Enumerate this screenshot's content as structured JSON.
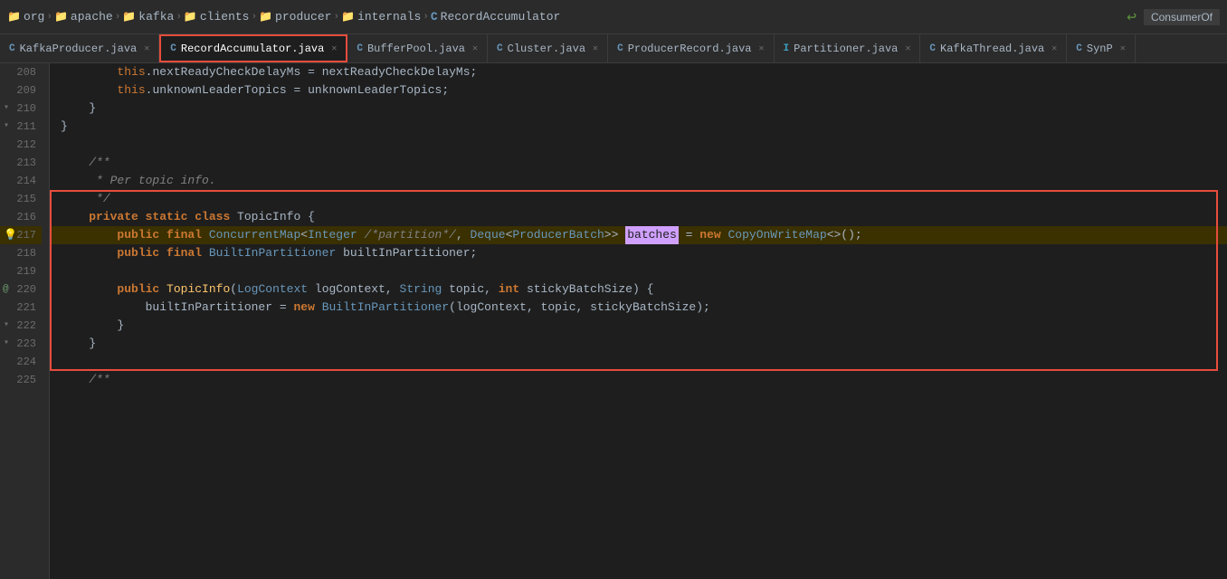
{
  "breadcrumb": {
    "items": [
      {
        "type": "folder",
        "label": "org"
      },
      {
        "type": "folder",
        "label": "apache"
      },
      {
        "type": "folder",
        "label": "kafka"
      },
      {
        "type": "folder",
        "label": "clients"
      },
      {
        "type": "folder",
        "label": "producer"
      },
      {
        "type": "folder",
        "label": "internals"
      },
      {
        "type": "class",
        "label": "RecordAccumulator"
      }
    ],
    "right_icon": "↩",
    "right_label": "ConsumerOf"
  },
  "tabs": [
    {
      "id": "kafka-producer",
      "label": "KafkaProducer.java",
      "icon": "C",
      "icon_type": "java",
      "active": false,
      "highlighted": false
    },
    {
      "id": "record-accumulator",
      "label": "RecordAccumulator.java",
      "icon": "C",
      "icon_type": "java",
      "active": true,
      "highlighted": true
    },
    {
      "id": "buffer-pool",
      "label": "BufferPool.java",
      "icon": "C",
      "icon_type": "java",
      "active": false,
      "highlighted": false
    },
    {
      "id": "cluster",
      "label": "Cluster.java",
      "icon": "C",
      "icon_type": "java",
      "active": false,
      "highlighted": false
    },
    {
      "id": "producer-record",
      "label": "ProducerRecord.java",
      "icon": "C",
      "icon_type": "java",
      "active": false,
      "highlighted": false
    },
    {
      "id": "partitioner",
      "label": "Partitioner.java",
      "icon": "I",
      "icon_type": "interface",
      "active": false,
      "highlighted": false
    },
    {
      "id": "kafka-thread",
      "label": "KafkaThread.java",
      "icon": "C",
      "icon_type": "java",
      "active": false,
      "highlighted": false
    },
    {
      "id": "synp",
      "label": "SynP",
      "icon": "C",
      "icon_type": "java",
      "active": false,
      "highlighted": false
    }
  ],
  "lines": [
    {
      "num": 208,
      "content": "        this.nextReadyCheckDelayMs = nextReadyCheckDelayMs;",
      "gutter_icon": null,
      "highlighted": false
    },
    {
      "num": 209,
      "content": "        this.unknownLeaderTopics = unknownLeaderTopics;",
      "gutter_icon": null,
      "highlighted": false
    },
    {
      "num": 210,
      "content": "    }",
      "gutter_icon": "arrow_down",
      "highlighted": false
    },
    {
      "num": 211,
      "content": "}",
      "gutter_icon": "arrow_down",
      "highlighted": false
    },
    {
      "num": 212,
      "content": "",
      "gutter_icon": null,
      "highlighted": false
    },
    {
      "num": 213,
      "content": "    /**",
      "gutter_icon": null,
      "highlighted": false
    },
    {
      "num": 214,
      "content": "     * Per topic info.",
      "gutter_icon": null,
      "highlighted": false
    },
    {
      "num": 215,
      "content": "     */",
      "gutter_icon": null,
      "highlighted": false,
      "in_red_box": true
    },
    {
      "num": 216,
      "content": "    private static class TopicInfo {",
      "gutter_icon": null,
      "highlighted": false,
      "in_red_box": true
    },
    {
      "num": 217,
      "content": "        public final ConcurrentMap<Integer /*partition*/, Deque<ProducerBatch>> batches = new CopyOnWriteMap<>();",
      "gutter_icon": "bulb",
      "highlighted": true,
      "in_red_box": true
    },
    {
      "num": 218,
      "content": "        public final BuiltInPartitioner builtInPartitioner;",
      "gutter_icon": null,
      "highlighted": false,
      "in_red_box": true
    },
    {
      "num": 219,
      "content": "",
      "gutter_icon": null,
      "highlighted": false,
      "in_red_box": true
    },
    {
      "num": 220,
      "content": "        public TopicInfo(LogContext logContext, String topic, int stickyBatchSize) {",
      "gutter_icon": "at",
      "highlighted": false,
      "in_red_box": true
    },
    {
      "num": 221,
      "content": "            builtInPartitioner = new BuiltInPartitioner(logContext, topic, stickyBatchSize);",
      "gutter_icon": null,
      "highlighted": false,
      "in_red_box": true
    },
    {
      "num": 222,
      "content": "        }",
      "gutter_icon": "arrow_down",
      "highlighted": false,
      "in_red_box": true
    },
    {
      "num": 223,
      "content": "    }",
      "gutter_icon": "arrow_down",
      "highlighted": false,
      "in_red_box": true
    },
    {
      "num": 224,
      "content": "",
      "gutter_icon": null,
      "highlighted": false,
      "in_red_box": true
    },
    {
      "num": 225,
      "content": "    /**",
      "gutter_icon": null,
      "highlighted": false
    }
  ]
}
